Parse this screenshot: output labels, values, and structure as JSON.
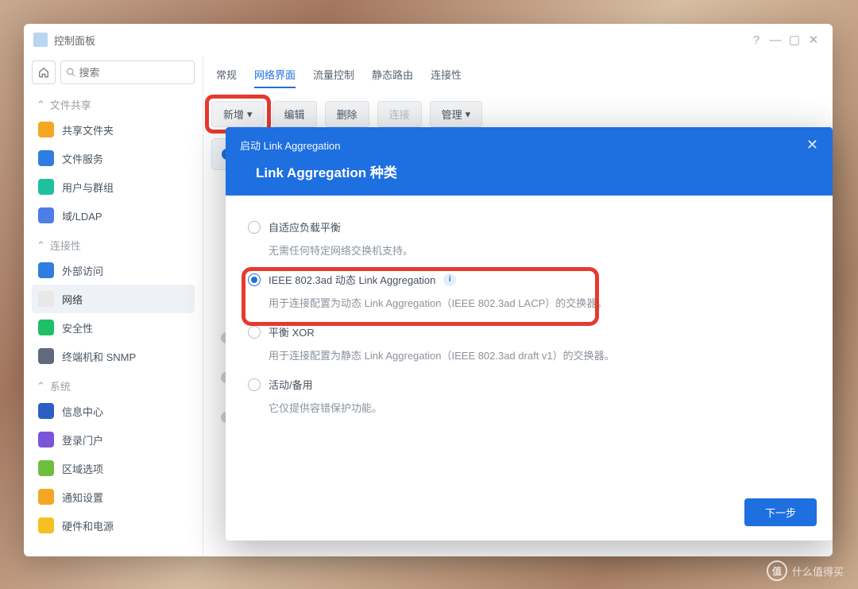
{
  "window": {
    "title": "控制面板"
  },
  "controls": {
    "help": "?",
    "min": "—",
    "max": "▢",
    "close": "✕"
  },
  "search": {
    "placeholder": "搜索"
  },
  "sidebar": {
    "groups": [
      {
        "label": "文件共享",
        "items": [
          {
            "label": "共享文件夹",
            "iconClass": "orange"
          },
          {
            "label": "文件服务",
            "iconClass": "blue"
          },
          {
            "label": "用户与群组",
            "iconClass": "teal"
          },
          {
            "label": "域/LDAP",
            "iconClass": "navy"
          }
        ]
      },
      {
        "label": "连接性",
        "items": [
          {
            "label": "外部访问",
            "iconClass": "blue"
          },
          {
            "label": "网络",
            "iconClass": "house",
            "active": true
          },
          {
            "label": "安全性",
            "iconClass": "green"
          },
          {
            "label": "终端机和 SNMP",
            "iconClass": "grey"
          }
        ]
      },
      {
        "label": "系统",
        "items": [
          {
            "label": "信息中心",
            "iconClass": "darkblue"
          },
          {
            "label": "登录门户",
            "iconClass": "purple"
          },
          {
            "label": "区域选项",
            "iconClass": "lime"
          },
          {
            "label": "通知设置",
            "iconClass": "orange"
          },
          {
            "label": "硬件和电源",
            "iconClass": "yellow"
          }
        ]
      }
    ]
  },
  "tabs": [
    {
      "label": "常规"
    },
    {
      "label": "网络界面",
      "active": true
    },
    {
      "label": "流量控制"
    },
    {
      "label": "静态路由"
    },
    {
      "label": "连接性"
    }
  ],
  "toolbar": {
    "add": "新增",
    "edit": "编辑",
    "delete": "删除",
    "connect": "连接",
    "manage": "管理"
  },
  "modal": {
    "breadcrumb": "启动 Link Aggregation",
    "title": "Link Aggregation 种类",
    "options": [
      {
        "title": "自适应负载平衡",
        "desc": "无需任何特定网络交换机支持。"
      },
      {
        "title": "IEEE 802.3ad 动态 Link Aggregation",
        "desc": "用于连接配置为动态 Link Aggregation（IEEE 802.3ad LACP）的交换器。",
        "selected": true,
        "highlight": true,
        "info": true
      },
      {
        "title": "平衡 XOR",
        "desc": "用于连接配置为静态 Link Aggregation（IEEE 802.3ad draft v1）的交换器。"
      },
      {
        "title": "活动/备用",
        "desc": "它仅提供容错保护功能。"
      }
    ],
    "next": "下一步"
  },
  "watermark": {
    "text": "什么值得买",
    "badge": "值"
  }
}
